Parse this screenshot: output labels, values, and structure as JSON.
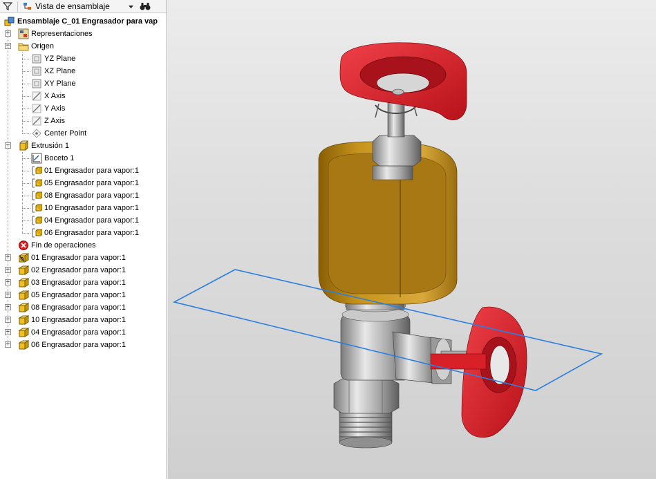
{
  "toolbar": {
    "filter_icon": "filter-icon",
    "view_label": "Vista de ensamblaje",
    "dropdown_icon": "caret-down-icon",
    "find_icon": "binoculars-icon"
  },
  "tree": {
    "root": "Ensamblaje C_01 Engrasador para vap",
    "representations": "Representaciones",
    "origin": "Origen",
    "origin_items": [
      "YZ Plane",
      "XZ Plane",
      "XY Plane",
      "X Axis",
      "Y Axis",
      "Z Axis",
      "Center Point"
    ],
    "extrusion": "Extrusión 1",
    "sketch": "Boceto 1",
    "extrusion_parts": [
      "01 Engrasador para vapor:1",
      "05 Engrasador para vapor:1",
      "08 Engrasador para vapor:1",
      "10 Engrasador para vapor:1",
      "04 Engrasador para vapor:1",
      "06 Engrasador para vapor:1"
    ],
    "end_of_features": "Fin de operaciones",
    "components": [
      "01 Engrasador para vapor:1",
      "02 Engrasador para vapor:1",
      "03 Engrasador para vapor:1",
      "05 Engrasador para vapor:1",
      "08 Engrasador para vapor:1",
      "10 Engrasador para vapor:1",
      "04 Engrasador para vapor:1",
      "06 Engrasador para vapor:1"
    ]
  },
  "colors": {
    "handwheel": "#e0202a",
    "reservoir": "#c8961e",
    "steel": "#b8b8b8",
    "work_plane": "#2a7fe0"
  }
}
